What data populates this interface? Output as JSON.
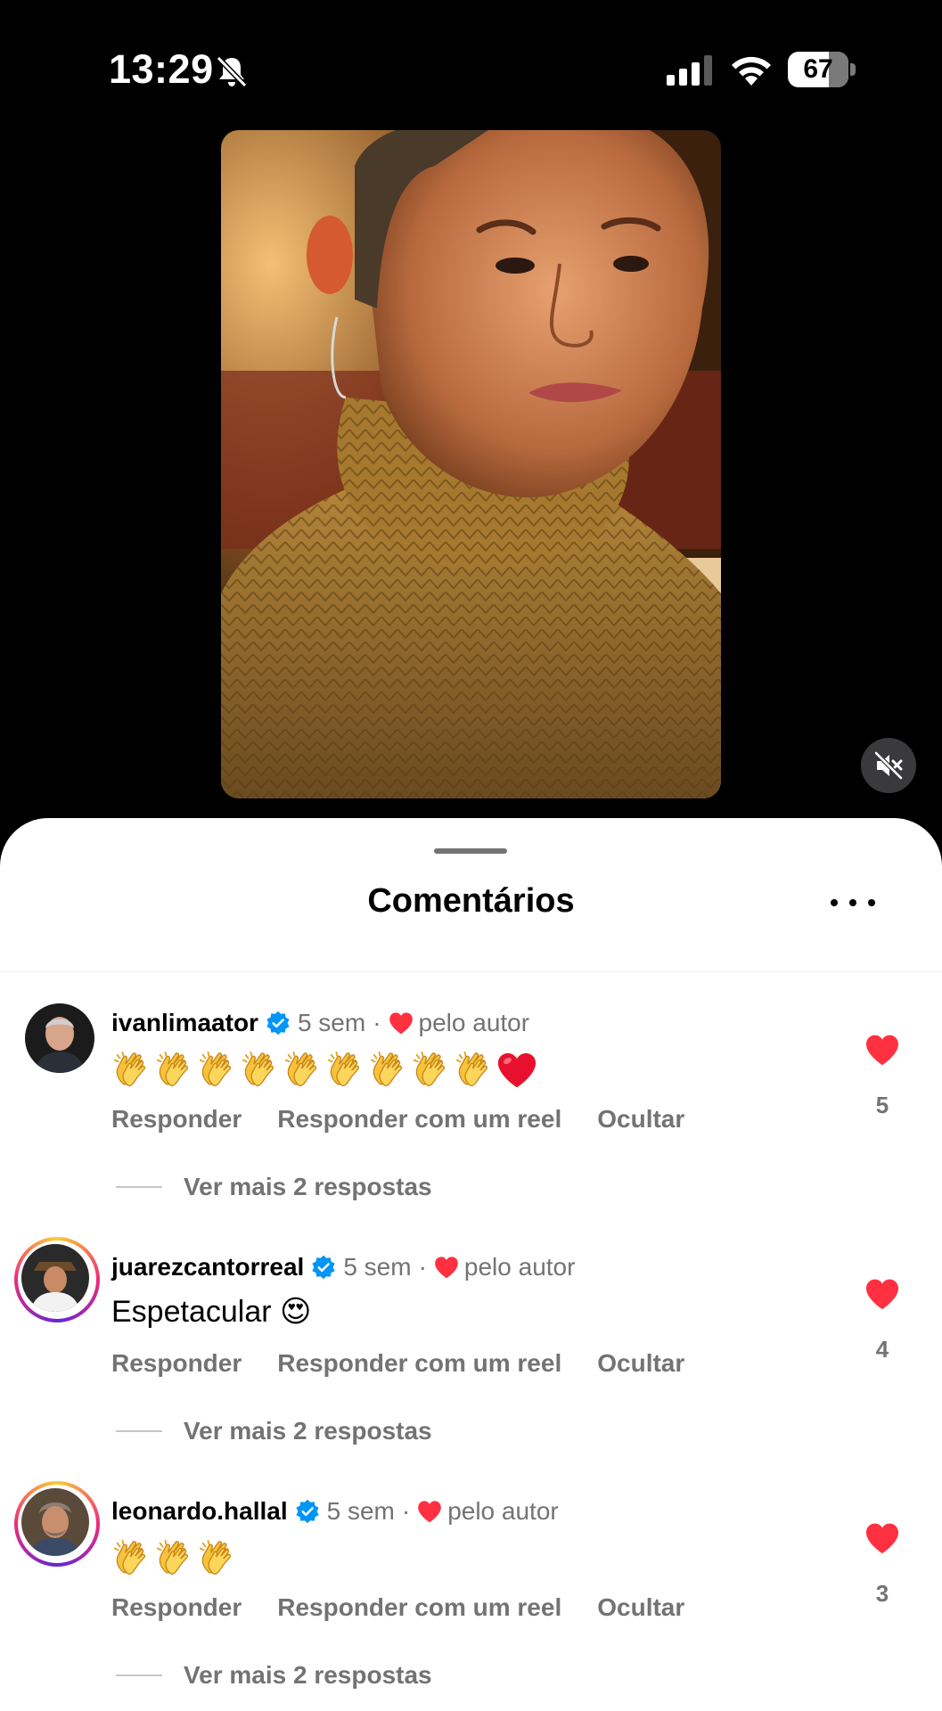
{
  "status_bar": {
    "time": "13:29",
    "battery": "67"
  },
  "sheet": {
    "title": "Comentários"
  },
  "comments": [
    {
      "username": "ivanlimaator",
      "time_ago": "5 sem",
      "separator": "·",
      "author_note": "pelo autor",
      "text": "",
      "emojis": [
        "clapping-hands",
        "clapping-hands",
        "clapping-hands",
        "clapping-hands",
        "clapping-hands",
        "clapping-hands",
        "clapping-hands",
        "clapping-hands",
        "clapping-hands",
        "red-heart"
      ],
      "actions": [
        "Responder",
        "Responder com um reel",
        "Ocultar"
      ],
      "replies": "Ver mais 2 respostas",
      "likes": "5"
    },
    {
      "username": "juarezcantorreal",
      "time_ago": "5 sem",
      "separator": "·",
      "author_note": "pelo autor",
      "text": "Espetacular 😍",
      "emojis": [],
      "actions": [
        "Responder",
        "Responder com um reel",
        "Ocultar"
      ],
      "replies": "Ver mais 2 respostas",
      "likes": "4"
    },
    {
      "username": "leonardo.hallal",
      "time_ago": "5 sem",
      "separator": "·",
      "author_note": "pelo autor",
      "text": "",
      "emojis": [
        "clapping-hands",
        "clapping-hands",
        "clapping-hands"
      ],
      "actions": [
        "Responder",
        "Responder com um reel",
        "Ocultar"
      ],
      "replies": "Ver mais 2 respostas",
      "likes": "3"
    }
  ],
  "colors": {
    "like_red": "#ff3040",
    "verified_blue": "#0095f6",
    "secondary_text": "#737373"
  }
}
